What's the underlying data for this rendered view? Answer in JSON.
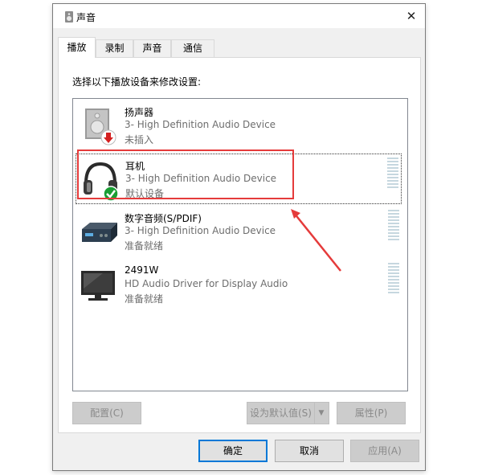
{
  "window": {
    "title": "声音",
    "close_label": "✕"
  },
  "tabs": [
    {
      "label": "播放",
      "active": true
    },
    {
      "label": "录制",
      "active": false
    },
    {
      "label": "声音",
      "active": false
    },
    {
      "label": "通信",
      "active": false
    }
  ],
  "playback": {
    "instruction": "选择以下播放设备来修改设置:",
    "devices": [
      {
        "name": "扬声器",
        "description": "3- High Definition Audio Device",
        "status": "未插入",
        "icon": "speaker-icon",
        "badge": "unplugged-badge-icon"
      },
      {
        "name": "耳机",
        "description": "3- High Definition Audio Device",
        "status": "默认设备",
        "icon": "headphones-icon",
        "badge": "default-check-badge-icon"
      },
      {
        "name": "数字音频(S/PDIF)",
        "description": "3- High Definition Audio Device",
        "status": "准备就绪",
        "icon": "digital-audio-icon"
      },
      {
        "name": "2491W",
        "description": "HD Audio Driver for Display Audio",
        "status": "准备就绪",
        "icon": "monitor-icon"
      }
    ],
    "buttons": {
      "configure": "配置(C)",
      "set_default": "设为默认值(S)",
      "properties": "属性(P)"
    }
  },
  "footer": {
    "ok": "确定",
    "cancel": "取消",
    "apply": "应用(A)"
  },
  "colors": {
    "annotation": "#e53b3b",
    "default_badge": "#1a9e34",
    "unplugged_badge": "#d42020",
    "primary_border": "#0078d7"
  }
}
